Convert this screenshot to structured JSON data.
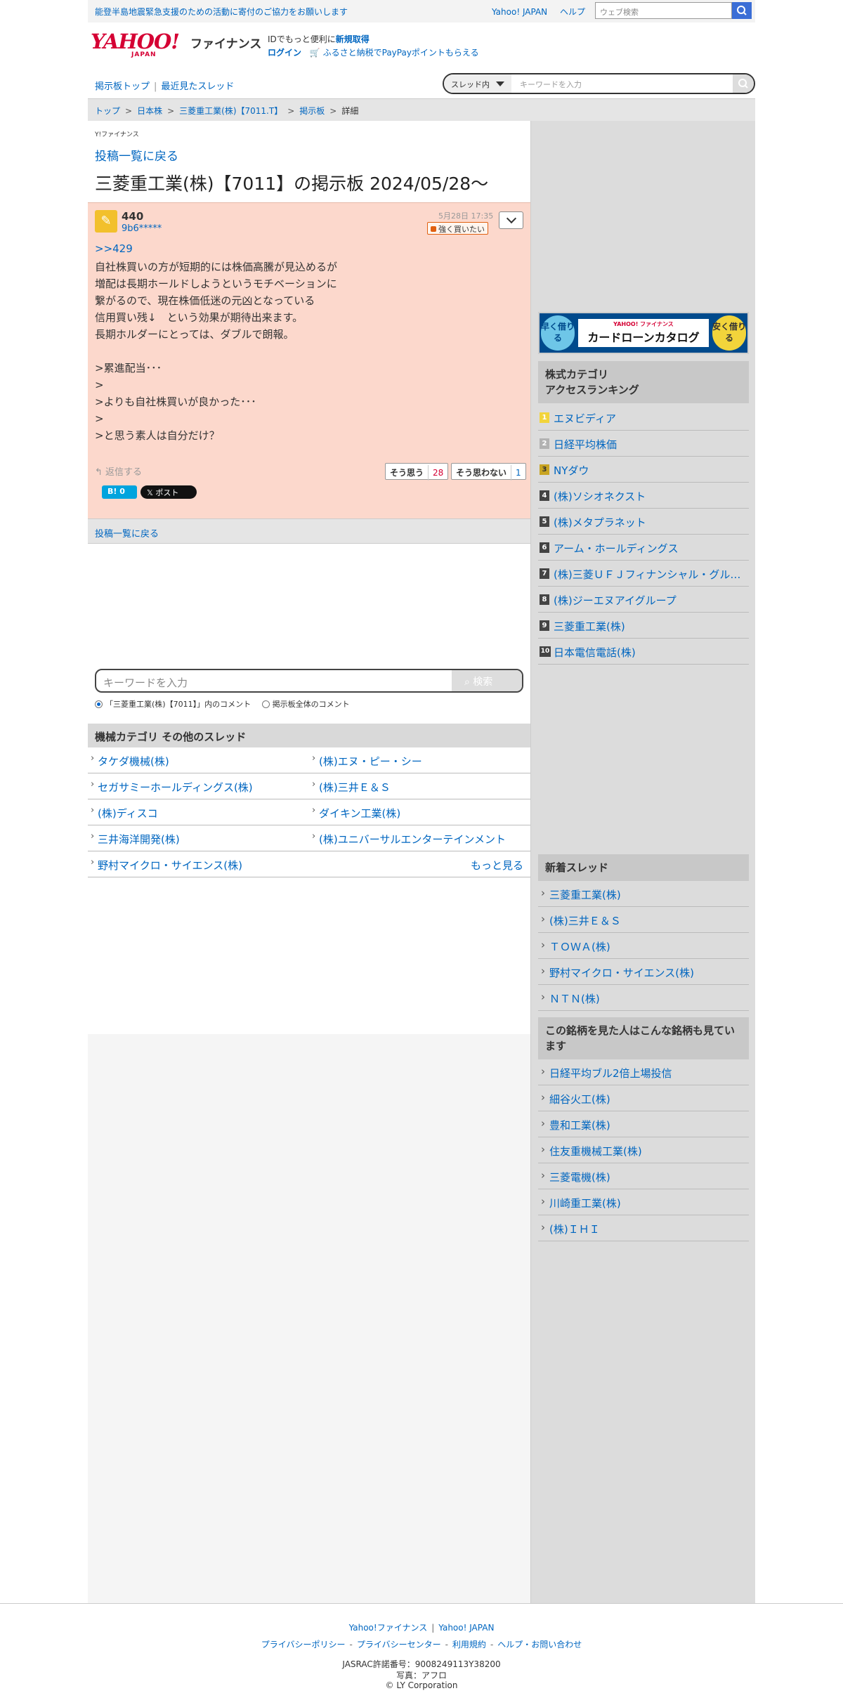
{
  "topbar": {
    "notice": "能登半島地震緊急支援のための活動に寄付のご協力をお願いします",
    "links": [
      "Yahoo! JAPAN",
      "ヘルプ"
    ],
    "web_search_placeholder": "ウェブ検索"
  },
  "header": {
    "logo_text": "YAHOO!",
    "logo_sub": "JAPAN",
    "finance_label": "ファイナンス",
    "id_text": "IDでもっと便利に",
    "signup": "新規取得",
    "login": "ログイン",
    "promo": "ふるさと納税でPayPayポイントもらえる"
  },
  "boardnav": {
    "board_top": "掲示板トップ",
    "recent": "最近見たスレッド",
    "search_scope": "スレッド内",
    "search_placeholder": "キーワードを入力"
  },
  "breadcrumb": [
    "トップ",
    "日本株",
    "三菱重工業(株)【7011.T】",
    "掲示板",
    "詳細"
  ],
  "main": {
    "mini_logo": "Y!ファイナンス",
    "back_link": "投稿一覧に戻る",
    "board_title": "三菱重工業(株)【7011】の掲示板 2024/05/28〜",
    "post": {
      "number": "440",
      "user": "9b6*****",
      "date": "5月28日 17:35",
      "sentiment": "強く買いたい",
      "reply_to": ">>429",
      "body": "自社株買いの方が短期的には株価高騰が見込めるが\n増配は長期ホールドしようというモチベーションに\n繋がるので、現在株価低迷の元凶となっている\n信用買い残↓　という効果が期待出来ます。\n長期ホルダーにとっては、ダブルで朗報。\n\n>累進配当･･･\n>\n>よりも自社株買いが良かった･･･\n>\n>と思う素人は自分だけ？",
      "reply_label": "返信する",
      "agree_label": "そう思う",
      "agree_count": "28",
      "disagree_label": "そう思わない",
      "disagree_count": "1",
      "hatena": "B! 0",
      "x_post": "𝕏 ポスト"
    },
    "back_bar": "投稿一覧に戻る",
    "search_placeholder": "キーワードを入力",
    "search_button": "検索",
    "radio_1": "「三菱重工業(株)【7011】」内のコメント",
    "radio_2": "掲示板全体のコメント",
    "other_head": "機械カテゴリ  その他のスレッド",
    "other_threads": [
      "タケダ機械(株)",
      "(株)エヌ・ピー・シー",
      "セガサミーホールディングス(株)",
      "(株)三井Ｅ＆Ｓ",
      "(株)ディスコ",
      "ダイキン工業(株)",
      "三井海洋開発(株)",
      "(株)ユニバーサルエンターテインメント",
      "野村マイクロ・サイエンス(株)"
    ],
    "more": "もっと見る"
  },
  "side": {
    "banner": {
      "left": "早く借りる",
      "right": "安く借りる",
      "small": "YAHOO! ファイナンス",
      "title": "カードローンカタログ"
    },
    "ranking_head": "株式カテゴリ\nアクセスランキング",
    "ranking": [
      "エヌビディア",
      "日経平均株価",
      "NYダウ",
      "(株)ソシオネクスト",
      "(株)メタプラネット",
      "アーム・ホールディングス",
      "(株)三菱ＵＦＪフィナンシャル・グループ",
      "(株)ジーエヌアイグループ",
      "三菱重工業(株)",
      "日本電信電話(株)"
    ],
    "new_head": "新着スレッド",
    "new_threads": [
      "三菱重工業(株)",
      "(株)三井Ｅ＆Ｓ",
      "ＴＯＷＡ(株)",
      "野村マイクロ・サイエンス(株)",
      "ＮＴＮ(株)"
    ],
    "related_head": "この銘柄を見た人はこんな銘柄も見ています",
    "related": [
      "日経平均ブル2倍上場投信",
      "細谷火工(株)",
      "豊和工業(株)",
      "住友重機械工業(株)",
      "三菱電機(株)",
      "川崎重工業(株)",
      "(株)ＩＨＩ"
    ]
  },
  "footer": {
    "links1": [
      "Yahoo!ファイナンス",
      "Yahoo! JAPAN"
    ],
    "links2": [
      "プライバシーポリシー",
      "プライバシーセンター",
      "利用規約",
      "ヘルプ・お問い合わせ"
    ],
    "jasrac": "JASRAC許諾番号：9008249113Y38200",
    "photo": "写真：アフロ",
    "copyright": "© LY Corporation"
  },
  "colors": {
    "accent": "#0066c0",
    "post_bg": "#fcd8cc",
    "brand_red": "#d50034"
  }
}
